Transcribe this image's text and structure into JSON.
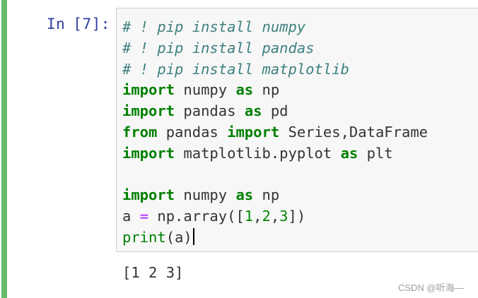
{
  "cell": {
    "prompt_label": "In",
    "prompt_number": "[7]:",
    "code_lines": [
      [
        {
          "t": "# ! pip install numpy",
          "c": "cm"
        }
      ],
      [
        {
          "t": "# ! pip install pandas",
          "c": "cm"
        }
      ],
      [
        {
          "t": "# ! pip install matplotlib",
          "c": "cm"
        }
      ],
      [
        {
          "t": "import",
          "c": "kw"
        },
        {
          "t": " numpy ",
          "c": "tx"
        },
        {
          "t": "as",
          "c": "kw"
        },
        {
          "t": " np",
          "c": "tx"
        }
      ],
      [
        {
          "t": "import",
          "c": "kw"
        },
        {
          "t": " pandas ",
          "c": "tx"
        },
        {
          "t": "as",
          "c": "kw"
        },
        {
          "t": " pd",
          "c": "tx"
        }
      ],
      [
        {
          "t": "from",
          "c": "kw"
        },
        {
          "t": " pandas ",
          "c": "tx"
        },
        {
          "t": "import",
          "c": "kw"
        },
        {
          "t": " Series,DataFrame",
          "c": "tx"
        }
      ],
      [
        {
          "t": "import",
          "c": "kw"
        },
        {
          "t": " matplotlib.pyplot ",
          "c": "tx"
        },
        {
          "t": "as",
          "c": "kw"
        },
        {
          "t": " plt",
          "c": "tx"
        }
      ],
      [],
      [
        {
          "t": "import",
          "c": "kw"
        },
        {
          "t": " numpy ",
          "c": "tx"
        },
        {
          "t": "as",
          "c": "kw"
        },
        {
          "t": " np",
          "c": "tx"
        }
      ],
      [
        {
          "t": "a ",
          "c": "tx"
        },
        {
          "t": "=",
          "c": "op"
        },
        {
          "t": " np.array([",
          "c": "tx"
        },
        {
          "t": "1",
          "c": "nm"
        },
        {
          "t": ",",
          "c": "tx"
        },
        {
          "t": "2",
          "c": "nm"
        },
        {
          "t": ",",
          "c": "tx"
        },
        {
          "t": "3",
          "c": "nm"
        },
        {
          "t": "])",
          "c": "tx"
        }
      ],
      [
        {
          "t": "print",
          "c": "bi"
        },
        {
          "t": "(a)",
          "c": "tx"
        }
      ]
    ],
    "output": "[1 2 3]"
  },
  "watermark": "CSDN @听海—",
  "colors": {
    "cell_bar": "#66bb6a",
    "prompt": "#303f9f",
    "comment": "#408080",
    "keyword": "#008000",
    "operator": "#aa22ff",
    "editor_bg": "#f7f7f7"
  }
}
